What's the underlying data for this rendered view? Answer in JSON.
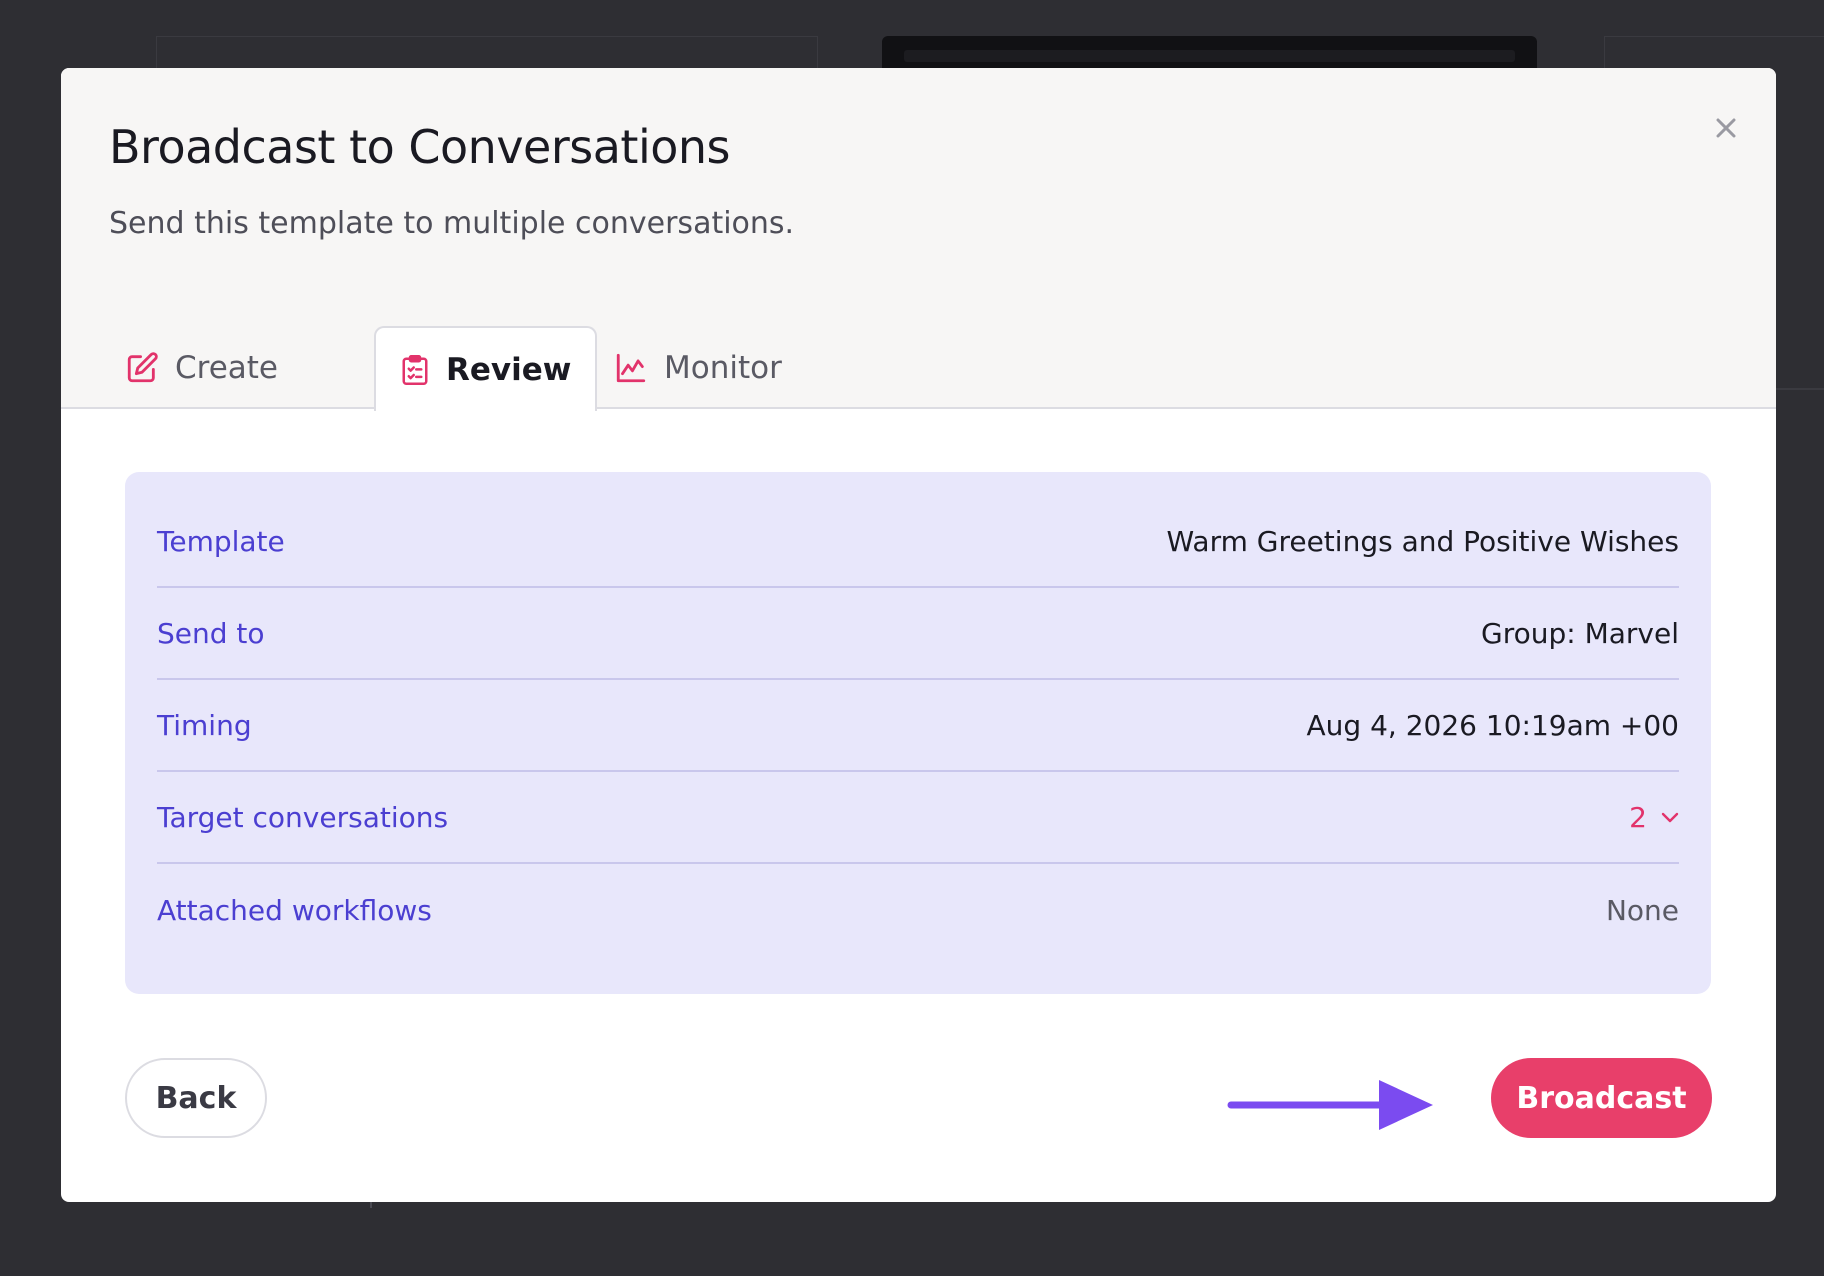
{
  "modal": {
    "title": "Broadcast to Conversations",
    "subtitle": "Send this template to multiple conversations.",
    "close_icon": "close-icon"
  },
  "tabs": [
    {
      "label": "Create",
      "icon": "edit-icon",
      "active": false
    },
    {
      "label": "Review",
      "icon": "clipboard-icon",
      "active": true
    },
    {
      "label": "Monitor",
      "icon": "line-chart-icon",
      "active": false
    }
  ],
  "summary": {
    "template": {
      "label": "Template",
      "value": "Warm Greetings and Positive Wishes"
    },
    "send_to": {
      "label": "Send to",
      "value": "Group: Marvel"
    },
    "timing": {
      "label": "Timing",
      "value": "Aug 4, 2026 10:19am +00"
    },
    "target_conversations": {
      "label": "Target conversations",
      "value": "2",
      "icon": "chevron-down-icon"
    },
    "attached_workflows": {
      "label": "Attached workflows",
      "value": "None"
    }
  },
  "footer": {
    "back_label": "Back",
    "broadcast_label": "Broadcast",
    "annotation_icon": "arrow-right-icon"
  },
  "colors": {
    "accent_pink": "#e83f6a",
    "label_purple": "#4b3fd1",
    "card_background": "#e8e7fb",
    "annotation_arrow": "#7b4bf0"
  }
}
